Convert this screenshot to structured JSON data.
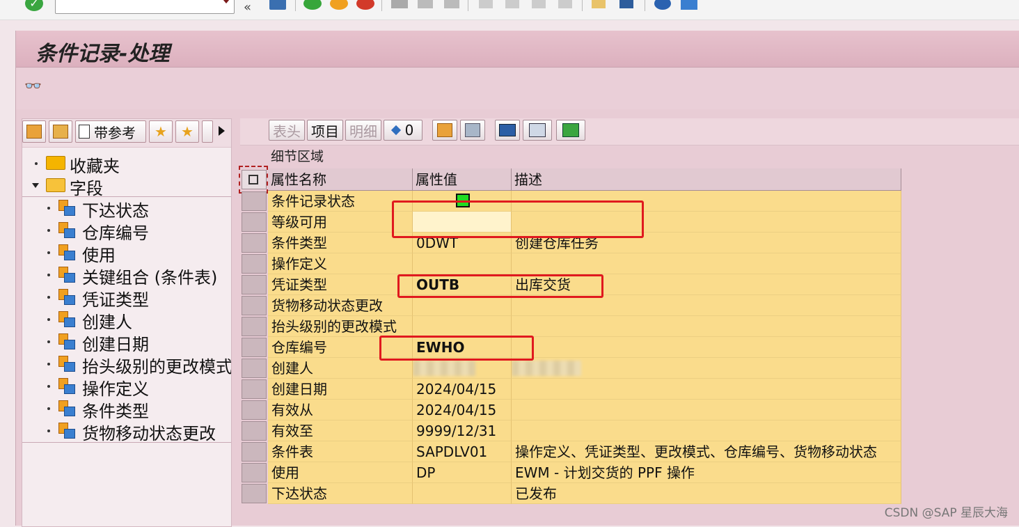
{
  "window": {
    "title": "条件记录-处理"
  },
  "left_toolbar": {
    "with_reference_label": "带参考"
  },
  "tree": {
    "favorites": "收藏夹",
    "fields_folder": "字段",
    "fields": [
      "下达状态",
      "仓库编号",
      "使用",
      "关键组合 (条件表)",
      "凭证类型",
      "创建人",
      "创建日期",
      "抬头级别的更改模式",
      "操作定义",
      "条件类型",
      "货物移动状态更改"
    ]
  },
  "right_toolbar": {
    "header_btn": "表头",
    "item_btn": "项目",
    "detail_btn": "明细",
    "count_btn": "0"
  },
  "detail": {
    "area_label": "细节区域",
    "columns": [
      "属性名称",
      "属性值",
      "描述"
    ],
    "rows": [
      {
        "name": "条件记录状态",
        "value": "",
        "desc": ""
      },
      {
        "name": "等级可用",
        "value": "",
        "desc": ""
      },
      {
        "name": "条件类型",
        "value": "0DWT",
        "desc": "创建仓库任务"
      },
      {
        "name": "操作定义",
        "value": "",
        "desc": ""
      },
      {
        "name": "凭证类型",
        "value": "OUTB",
        "desc": "出库交货"
      },
      {
        "name": "货物移动状态更改",
        "value": "",
        "desc": ""
      },
      {
        "name": "抬头级别的更改模式",
        "value": "",
        "desc": ""
      },
      {
        "name": "仓库编号",
        "value": "EWHO",
        "desc": ""
      },
      {
        "name": "创建人",
        "value": "",
        "desc": ""
      },
      {
        "name": "创建日期",
        "value": "2024/04/15",
        "desc": ""
      },
      {
        "name": "有效从",
        "value": "2024/04/15",
        "desc": ""
      },
      {
        "name": "有效至",
        "value": "9999/12/31",
        "desc": ""
      },
      {
        "name": "条件表",
        "value": "SAPDLV01",
        "desc": "操作定义、凭证类型、更改模式、仓库编号、货物移动状态"
      },
      {
        "name": "使用",
        "value": "DP",
        "desc": "EWM - 计划交货的 PPF 操作"
      },
      {
        "name": "下达状态",
        "value": "",
        "desc": "已发布"
      }
    ]
  },
  "watermark": "CSDN @SAP 星辰大海",
  "colors": {
    "row_bg": "#fadc8c",
    "title_bg": "#e7c2cd",
    "highlight": "#e0191e",
    "status_green": "#22dd22"
  }
}
